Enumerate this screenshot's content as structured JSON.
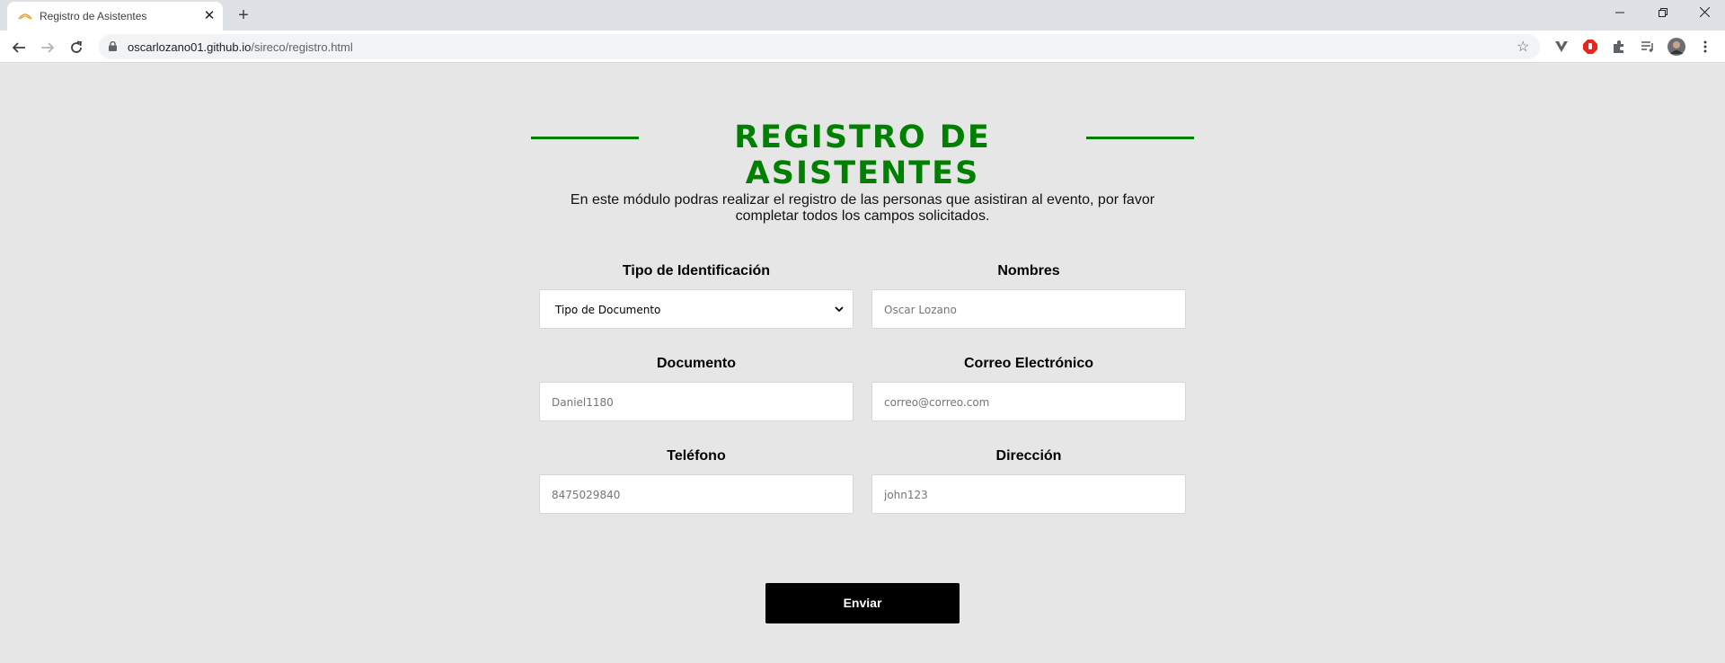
{
  "browser": {
    "tab_title": "Registro de Asistentes",
    "new_tab_symbol": "+",
    "url_host": "oscarlozano01.github.io",
    "url_path": "/sireco/registro.html",
    "window_controls": [
      "minimize-icon",
      "restore-icon",
      "close-icon"
    ],
    "extensions": [
      "vivaldi-extension-icon",
      "adblock-extension-icon",
      "puzzle-extensions-icon",
      "media-queue-icon",
      "profile-avatar"
    ]
  },
  "page": {
    "title": "REGISTRO DE ASISTENTES",
    "intro": "En este módulo podras realizar el registro de las personas que asistiran al evento, por favor completar todos los campos solicitados.",
    "accent_color": "#008000",
    "background_color": "#e6e6e6"
  },
  "form": {
    "tipo_label": "Tipo de Identificación",
    "tipo_selected": "Tipo de Documento",
    "nombres_label": "Nombres",
    "nombres_placeholder": "Oscar Lozano",
    "documento_label": "Documento",
    "documento_placeholder": "Daniel1180",
    "correo_label": "Correo Electrónico",
    "correo_placeholder": "correo@correo.com",
    "telefono_label": "Teléfono",
    "telefono_placeholder": "8475029840",
    "direccion_label": "Dirección",
    "direccion_placeholder": "john123",
    "submit_label": "Enviar"
  }
}
